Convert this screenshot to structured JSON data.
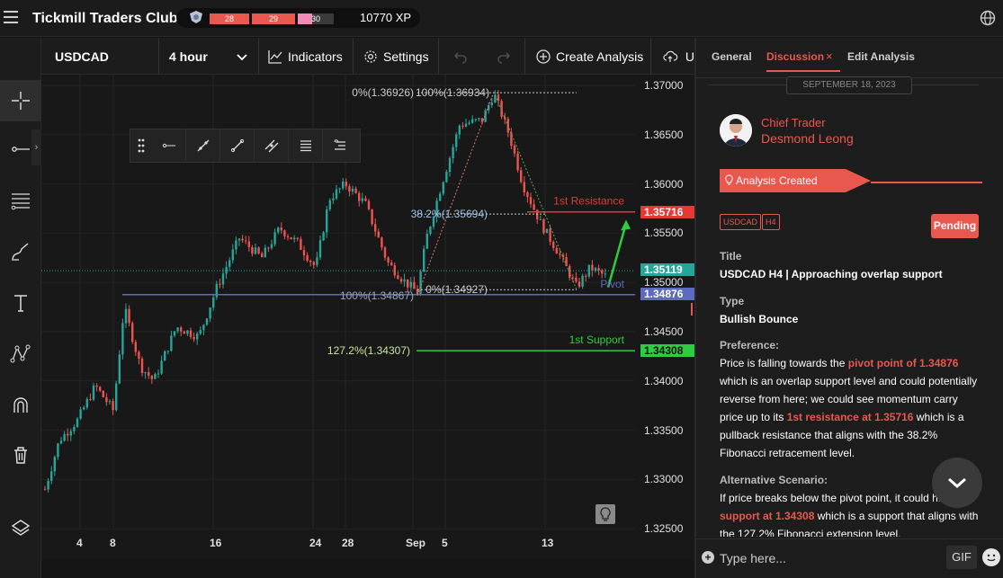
{
  "app": {
    "title": "Tickmill Traders Club",
    "xp": {
      "segments": [
        "28",
        "29",
        "30"
      ],
      "total": "10770 XP"
    }
  },
  "toolbar": {
    "symbol": "USDCAD",
    "timeframe": "4 hour",
    "indicators": "Indicators",
    "settings": "Settings",
    "create_analysis": "Create Analysis",
    "upload_partial": "U"
  },
  "chart": {
    "y_ticks": [
      "1.37000",
      "1.36500",
      "1.36000",
      "1.35500",
      "1.35000",
      "1.34500",
      "1.34000",
      "1.33500",
      "1.33000",
      "1.32500"
    ],
    "x_ticks": [
      "4",
      "8",
      "16",
      "24",
      "28",
      "Sep",
      "5",
      "13"
    ],
    "labels": {
      "resistance_price": "1.35716",
      "current_price": "1.35119",
      "pivot_price": "1.34876",
      "support_price": "1.34308"
    },
    "annotations": {
      "fib_top_0": "0%(1.36926)",
      "fib_top_100": "100%(1.36934)",
      "fib_382": "38.2%(1.35694)",
      "fib_bottom_100": "100%(1.34867)",
      "fib_bottom_0": "0%(1.34927)",
      "fib_1272": "127.2%(1.34307)",
      "resistance_text": "1st Resistance",
      "pivot_text": "Pivot",
      "support_text": "1st Support"
    },
    "colors": {
      "up": "#26a69a",
      "down": "#ef5350",
      "resistance": "#e53935",
      "pivot": "#5c6bc0",
      "support": "#2ecc40",
      "current": "#26a69a"
    }
  },
  "panel": {
    "tabs": [
      "General",
      "Discussion",
      "Edit Analysis"
    ],
    "active_tab": "Discussion",
    "date": "SEPTEMBER 18, 2023",
    "author_role": "Chief Trader",
    "author_name": "Desmond Leong",
    "status_ribbon": "Analysis Created",
    "tags": [
      "USDCAD",
      "H4"
    ],
    "status": "Pending",
    "title_label": "Title",
    "title_value": "USDCAD H4 | Approaching overlap support",
    "type_label": "Type",
    "type_value": "Bullish Bounce",
    "preference_label": "Preference:",
    "pref_t1": "Price is falling towards the ",
    "pref_h1": "pivot point of 1.34876",
    "pref_t2": " which is an overlap support level and could potentially reverse from here; we could see momentum carry price up to its ",
    "pref_h2": "1st resistance at 1.35716",
    "pref_t3": " which is a pullback resistance that aligns with the 38.2% Fibonacci retracement level.",
    "alt_label": "Alternative Scenario:",
    "alt_t1": "If price breaks below the pivot point, it could h",
    "alt_h1": "1st support at 1.34308",
    "alt_t2": " which is a support that aligns with the 127.2% Fibonacci extension level.",
    "composer_placeholder": "Type here...",
    "gif": "GIF"
  }
}
